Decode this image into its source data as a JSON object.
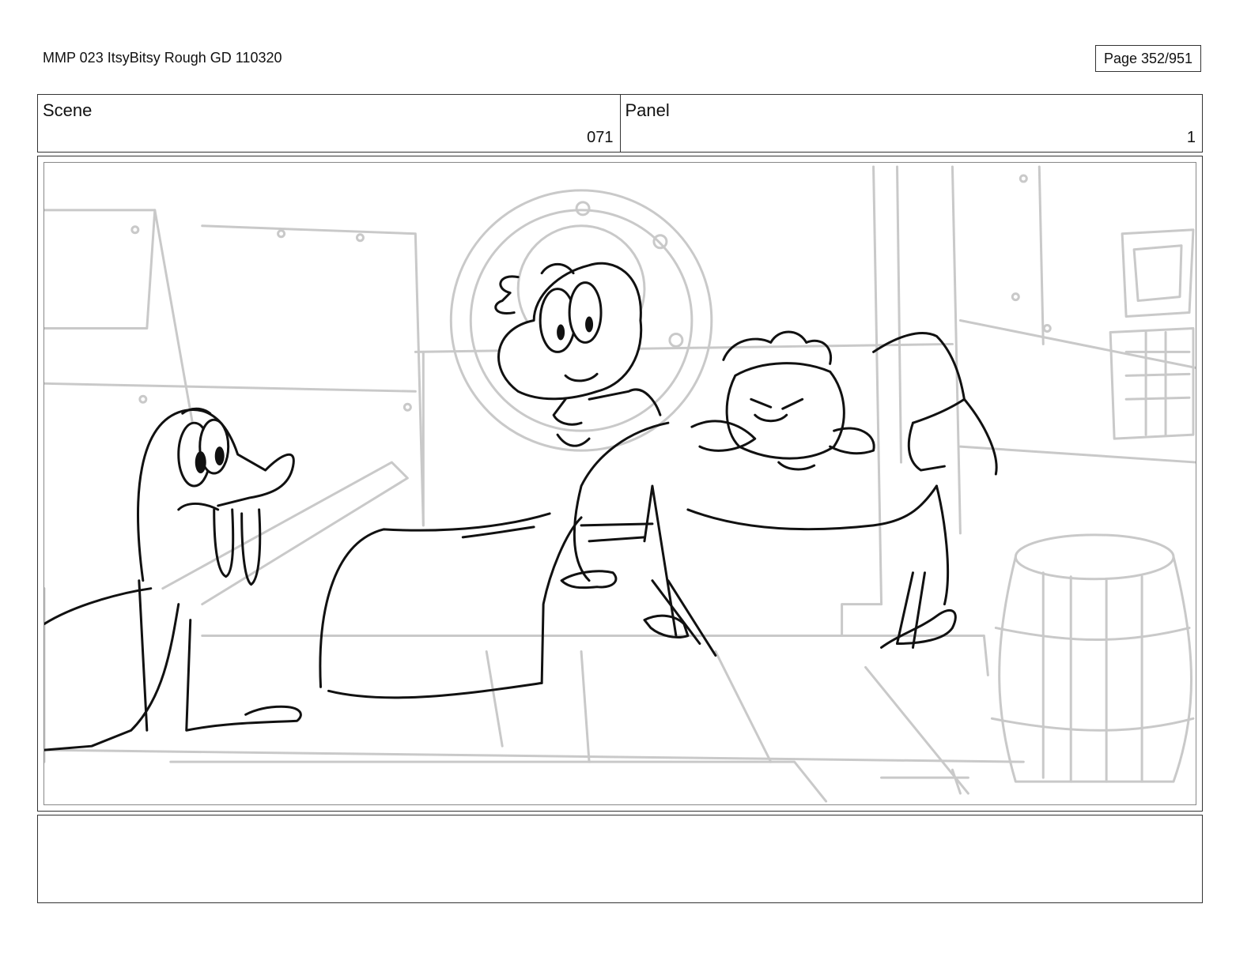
{
  "header": {
    "document_title": "MMP 023 ItsyBitsy Rough GD 110320",
    "page_label": "Page 352/951"
  },
  "info": {
    "scene_label": "Scene",
    "scene_value": "071",
    "panel_label": "Panel",
    "panel_value": "1"
  },
  "panel": {
    "drawing_style": "rough storyboard pencil sketch",
    "ink_color": "#111111",
    "background_line_color": "#c9c9c9"
  },
  "notes": {
    "text": ""
  }
}
